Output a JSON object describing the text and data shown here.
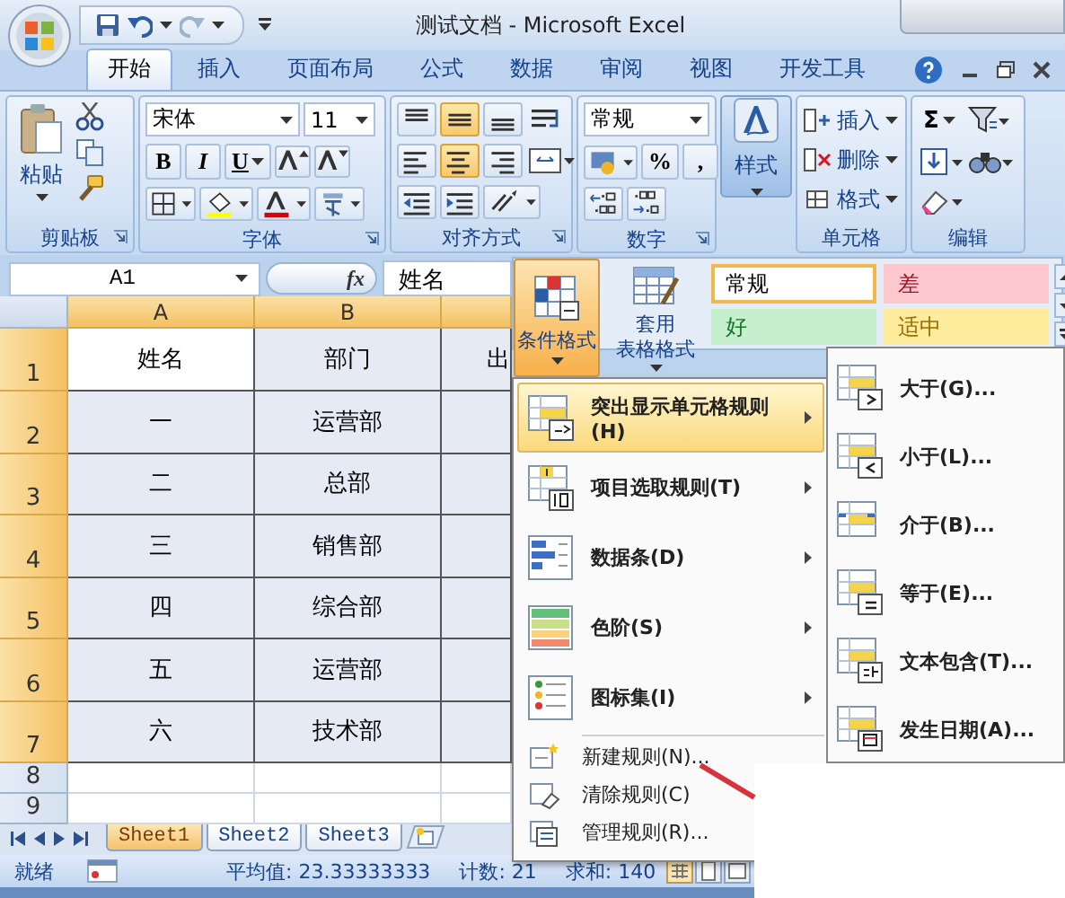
{
  "window": {
    "title": "测试文档 - Microsoft Excel"
  },
  "ribbon_tabs": [
    {
      "label": "开始",
      "selected": true
    },
    {
      "label": "插入",
      "selected": false
    },
    {
      "label": "页面布局",
      "selected": false
    },
    {
      "label": "公式",
      "selected": false
    },
    {
      "label": "数据",
      "selected": false
    },
    {
      "label": "审阅",
      "selected": false
    },
    {
      "label": "视图",
      "selected": false
    },
    {
      "label": "开发工具",
      "selected": false
    }
  ],
  "ribbon": {
    "clipboard": {
      "label": "剪贴板",
      "paste": "粘贴"
    },
    "font": {
      "label": "字体",
      "font_name": "宋体",
      "font_size": "11",
      "bold": "B",
      "italic": "I",
      "underline": "U"
    },
    "alignment": {
      "label": "对齐方式",
      "vertical": [
        {
          "selected": false
        },
        {
          "selected": true
        },
        {
          "selected": false
        }
      ],
      "horizontal": [
        {
          "selected": false
        },
        {
          "selected": true
        },
        {
          "selected": false
        }
      ]
    },
    "number": {
      "label": "数字",
      "format": "常规",
      "percent": "%",
      "comma": ","
    },
    "styles": {
      "button": "样式",
      "pressed": true
    },
    "cells": {
      "label": "单元格",
      "buttons": [
        "插入",
        "删除",
        "格式"
      ]
    },
    "editing": {
      "label": "编辑",
      "autosum": "Σ"
    }
  },
  "formula_bar": {
    "name_box": "A1",
    "function_button": "fx",
    "formula": "姓名"
  },
  "columns": [
    {
      "label": "A",
      "selected": true
    },
    {
      "label": "B",
      "selected": true
    },
    {
      "selected": true
    }
  ],
  "rows": [
    {
      "number": "1",
      "selected": true,
      "cells": [
        {
          "text": "姓名",
          "active": true
        },
        {
          "text": "部门",
          "active": false
        },
        {
          "text": "出",
          "active": false
        }
      ]
    },
    {
      "number": "2",
      "selected": true,
      "cells": [
        {
          "text": "一",
          "active": false
        },
        {
          "text": "运营部",
          "active": false
        }
      ]
    },
    {
      "number": "3",
      "selected": true,
      "cells": [
        {
          "text": "二",
          "active": false
        },
        {
          "text": "总部",
          "active": false
        }
      ]
    },
    {
      "number": "4",
      "selected": true,
      "cells": [
        {
          "text": "三",
          "active": false
        },
        {
          "text": "销售部",
          "active": false
        }
      ]
    },
    {
      "number": "5",
      "selected": true,
      "cells": [
        {
          "text": "四",
          "active": false
        },
        {
          "text": "综合部",
          "active": false
        }
      ]
    },
    {
      "number": "6",
      "selected": true,
      "cells": [
        {
          "text": "五",
          "active": false
        },
        {
          "text": "运营部",
          "active": false
        }
      ]
    },
    {
      "number": "7",
      "selected": true,
      "cells": [
        {
          "text": "六",
          "active": false
        },
        {
          "text": "技术部",
          "active": false
        }
      ]
    },
    {
      "number": "8",
      "selected": false
    },
    {
      "number": "9",
      "selected": false
    }
  ],
  "styles_gallery": {
    "conditional_formatting": {
      "label": "条件格式",
      "pressed": true
    },
    "format_as_table": {
      "lines": [
        "套用",
        "表格格式"
      ]
    },
    "cell_styles": [
      {
        "label": "常规",
        "color": "#ffffff",
        "selected": true
      },
      {
        "label": "差",
        "color": "#ffc7ce",
        "selected": false
      },
      {
        "label": "好",
        "color": "#c6efce",
        "selected": false
      },
      {
        "label": "适中",
        "color": "#ffeb9c",
        "selected": false
      }
    ]
  },
  "conditional_menu": {
    "rule_types": [
      {
        "label": "突出显示单元格规则(H)",
        "kind": "highlight",
        "selected": true
      },
      {
        "label": "项目选取规则(T)",
        "kind": "top",
        "selected": false
      },
      {
        "label": "数据条(D)",
        "kind": "databar",
        "selected": false
      },
      {
        "label": "色阶(S)",
        "kind": "colorscale",
        "selected": false
      },
      {
        "label": "图标集(I)",
        "kind": "iconset",
        "selected": false
      }
    ],
    "actions": [
      {
        "label": "新建规则(N)...",
        "kind": "new"
      },
      {
        "label": "清除规则(C)",
        "kind": "clear"
      },
      {
        "label": "管理规则(R)...",
        "kind": "manage"
      }
    ]
  },
  "submenu": [
    {
      "label": "大于(G)...",
      "kind": "greater"
    },
    {
      "label": "小于(L)...",
      "kind": "less"
    },
    {
      "label": "介于(B)...",
      "kind": "between"
    },
    {
      "label": "等于(E)...",
      "kind": "equal"
    },
    {
      "label": "文本包含(T)...",
      "kind": "text"
    },
    {
      "label": "发生日期(A)...",
      "kind": "date"
    }
  ],
  "sheet_tabs": [
    {
      "label": "Sheet1",
      "selected": true
    },
    {
      "label": "Sheet2",
      "selected": false
    },
    {
      "label": "Sheet3",
      "selected": false
    }
  ],
  "status_bar": {
    "mode": "就绪",
    "average": "平均值: 23.33333333",
    "count": "计数: 21",
    "sum": "求和: 140"
  }
}
